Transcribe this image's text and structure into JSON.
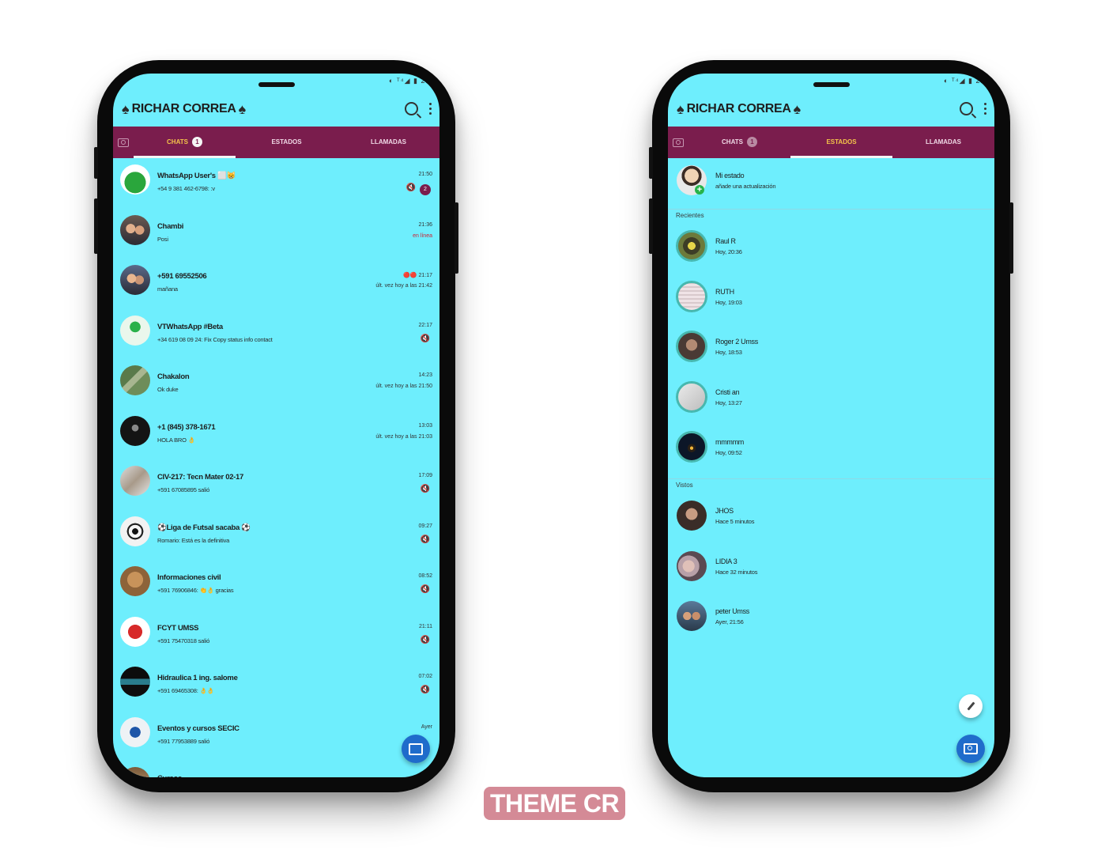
{
  "brand_label": "THEME CR",
  "colors": {
    "screen_bg": "#6eeefd",
    "tabbar_bg": "#7a1d4d",
    "active_tab": "#f5c54a",
    "fab": "#1f6ccb"
  },
  "left_phone": {
    "status_text": "◐ ᵀ⁴◢ ▮ 21:",
    "title": "RICHAR CORREA",
    "tabs": {
      "chats": "CHATS",
      "chats_badge": "1",
      "estados": "ESTADOS",
      "llamadas": "LLAMADAS",
      "active": "chats"
    },
    "chats": [
      {
        "name": "WhatsApp User's ⬜😸",
        "message": "+54 9 381 462-6798: :v",
        "time": "21:50",
        "unread": "2",
        "avatar": "green-hat"
      },
      {
        "name": "Chambi",
        "message": "Posi",
        "time": "21:36",
        "sub": "en línea",
        "avatar": "couple"
      },
      {
        "name": "+591 69552506",
        "message": "mañana",
        "time": "🔴🔴 21:17",
        "sub": "últ. vez hoy a las 21:42",
        "avatar": "couple2"
      },
      {
        "name": "VTWhatsApp #Beta",
        "message": "+34 619 08 09 24: Fix Copy status info contact",
        "time": "22:17",
        "avatar": "whatsapp"
      },
      {
        "name": "Chakalon",
        "message": "Ok duke",
        "time": "14:23",
        "sub": "últ. vez hoy a las 21:50",
        "avatar": "field"
      },
      {
        "name": "+1 (845) 378-1671",
        "message": "HOLA BRO 👌",
        "time": "13:03",
        "sub": "últ. vez hoy a las 21:03",
        "avatar": "dark"
      },
      {
        "name": "CIV-217: Tecn Mater 02-17",
        "message": "+591 67085895 salió",
        "time": "17:09",
        "avatar": "map"
      },
      {
        "name": "⚽Liga de Futsal sacaba ⚽",
        "message": "Romario: Está es la definitiva",
        "time": "09:27",
        "avatar": "ball"
      },
      {
        "name": "Informaciones civil",
        "message": "+591 76906846: 👏👌 gracias",
        "time": "08:52",
        "avatar": "dog"
      },
      {
        "name": "FCYT UMSS",
        "message": "+591 75470318 salió",
        "time": "21:11",
        "avatar": "fcyt"
      },
      {
        "name": "Hidraulica 1 ing. salome",
        "message": "+591 69465308: 👌👌",
        "time": "07:02",
        "avatar": "water"
      },
      {
        "name": "Eventos y cursos SECIC",
        "message": "+591 77953889 salió",
        "time": "Ayer",
        "avatar": "secic"
      },
      {
        "name": "Cursos",
        "message": "",
        "time": "",
        "avatar": "partial"
      }
    ]
  },
  "right_phone": {
    "status_text": "◐ ᵀ⁴◢ ▮ 21:",
    "title": "RICHAR CORREA",
    "tabs": {
      "chats": "CHATS",
      "chats_badge": "1",
      "estados": "ESTADOS",
      "llamadas": "LLAMADAS",
      "active": "estados"
    },
    "my_status": {
      "name": "Mi estado",
      "sub": "añade una actualización"
    },
    "recent_label": "Recientes",
    "recent": [
      {
        "name": "Raul R",
        "time": "Hoy, 20:36",
        "avatar": "raul"
      },
      {
        "name": "RUTH",
        "time": "Hoy, 19:03",
        "avatar": "ruth"
      },
      {
        "name": "Roger 2 Umss",
        "time": "Hoy, 18:53",
        "avatar": "roger"
      },
      {
        "name": "Cristi an",
        "time": "Hoy, 13:27",
        "avatar": "cristian"
      },
      {
        "name": "mmmmm",
        "time": "Hoy, 09:52",
        "avatar": "night"
      }
    ],
    "seen_label": "Vistos",
    "seen": [
      {
        "name": "JHOS",
        "time": "Hace 5 minutos",
        "avatar": "jhos"
      },
      {
        "name": "LIDIA 3",
        "time": "Hace 32 minutos",
        "avatar": "lidia"
      },
      {
        "name": "peter Umss",
        "time": "Ayer, 21:56",
        "avatar": "peter"
      }
    ]
  }
}
